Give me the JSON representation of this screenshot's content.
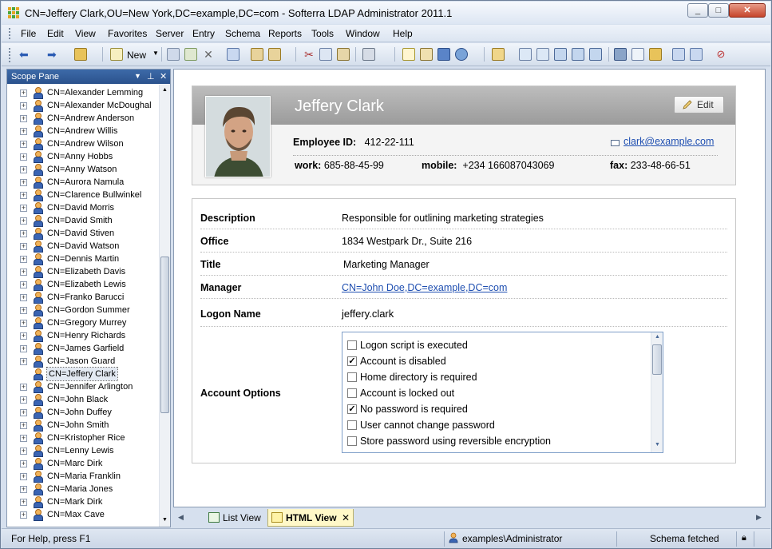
{
  "window": {
    "title": "CN=Jeffery Clark,OU=New York,DC=example,DC=com - Softerra LDAP Administrator 2011.1"
  },
  "menu": [
    "File",
    "Edit",
    "View",
    "Favorites",
    "Server",
    "Entry",
    "Schema",
    "Reports",
    "Tools",
    "Window",
    "Help"
  ],
  "toolbar": {
    "new_label": "New"
  },
  "scope": {
    "title": "Scope Pane",
    "items": [
      "CN=Alexander Lemming",
      "CN=Alexander McDoughal",
      "CN=Andrew Anderson",
      "CN=Andrew Willis",
      "CN=Andrew Wilson",
      "CN=Anny Hobbs",
      "CN=Anny Watson",
      "CN=Aurora Namula",
      "CN=Clarence Bullwinkel",
      "CN=David Morris",
      "CN=David Smith",
      "CN=David Stiven",
      "CN=David Watson",
      "CN=Dennis Martin",
      "CN=Elizabeth Davis",
      "CN=Elizabeth Lewis",
      "CN=Franko Barucci",
      "CN=Gordon Summer",
      "CN=Gregory Murrey",
      "CN=Henry Richards",
      "CN=James Garfield",
      "CN=Jason Guard",
      "CN=Jeffery Clark",
      "CN=Jennifer Arlington",
      "CN=John Black",
      "CN=John Duffey",
      "CN=John Smith",
      "CN=Kristopher Rice",
      "CN=Lenny Lewis",
      "CN=Marc Dirk",
      "CN=Maria Franklin",
      "CN=Maria Jones",
      "CN=Mark Dirk",
      "CN=Max Cave"
    ],
    "selected_index": 22
  },
  "card": {
    "name": "Jeffery Clark",
    "edit_label": "Edit",
    "employee_id_label": "Employee ID:",
    "employee_id": "412-22-111",
    "email": "clark@example.com",
    "work_label": "work:",
    "work": "685-88-45-99",
    "mobile_label": "mobile:",
    "mobile": "+234 166087043069",
    "fax_label": "fax:",
    "fax": "233-48-66-51"
  },
  "details": {
    "description_label": "Description",
    "description": "Responsible for outlining marketing strategies",
    "office_label": "Office",
    "office": "1834 Westpark Dr., Suite 216",
    "title_label": "Title",
    "title": "Marketing Manager",
    "manager_label": "Manager",
    "manager": "CN=John Doe,DC=example,DC=com",
    "logon_label": "Logon Name",
    "logon": "jeffery.clark",
    "options_label": "Account Options",
    "options": [
      {
        "label": "Logon script is executed",
        "checked": false
      },
      {
        "label": "Account is disabled",
        "checked": true
      },
      {
        "label": "Home directory is required",
        "checked": false
      },
      {
        "label": "Account is locked out",
        "checked": false
      },
      {
        "label": "No password is required",
        "checked": true
      },
      {
        "label": "User cannot change password",
        "checked": false
      },
      {
        "label": "Store password using reversible encryption",
        "checked": false
      }
    ]
  },
  "tabs": {
    "list_view": "List View",
    "html_view": "HTML View"
  },
  "status": {
    "help": "For Help, press F1",
    "user": "examples\\Administrator",
    "schema": "Schema fetched"
  }
}
